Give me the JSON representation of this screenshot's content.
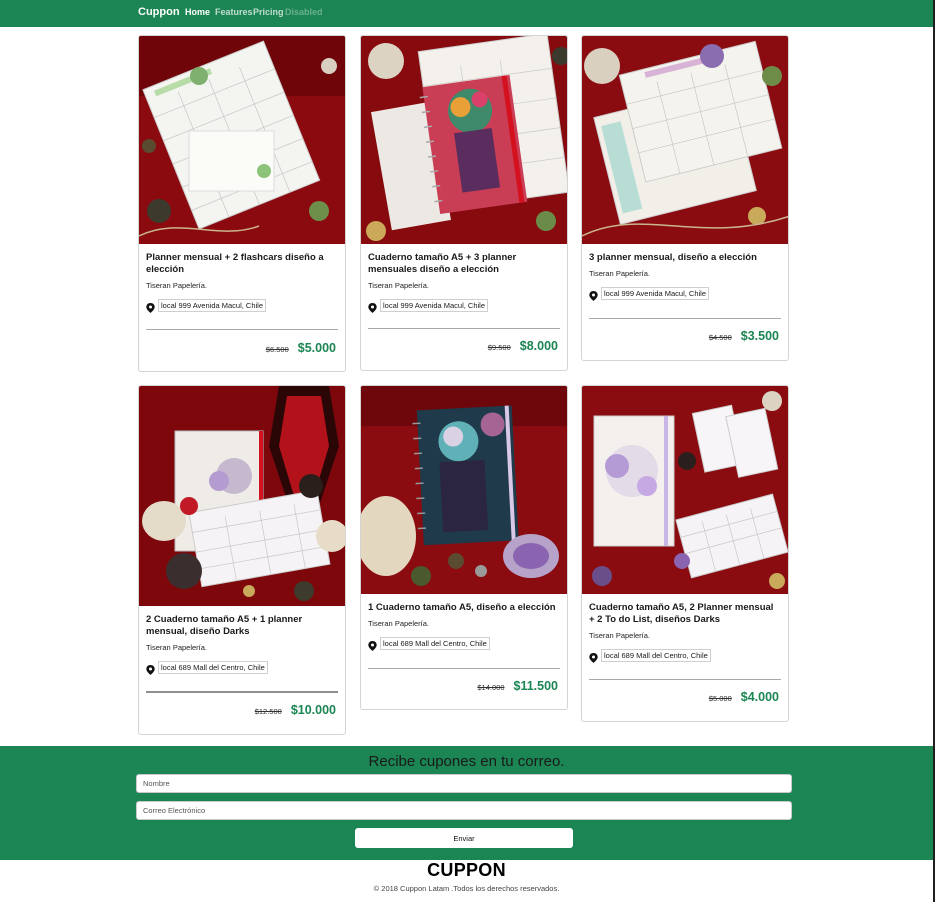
{
  "navbar": {
    "brand": "Cuppon",
    "links": [
      "Home",
      "Features",
      "Pricing",
      "Disabled"
    ],
    "color": "#1b8553"
  },
  "products": [
    {
      "title": "Planner mensual + 2 flashcars diseño a elección",
      "store": "Tiseran Papelería.",
      "location": "local 999 Avenida Macul, Chile",
      "old_price": "$6.500",
      "price": "$5.000",
      "image": "planner-photo"
    },
    {
      "title": "Cuaderno tamaño A5 + 3 planner mensuales diseño a elección",
      "store": "Tiseran Papelería.",
      "location": "local 999 Avenida Macul, Chile",
      "old_price": "$9.500",
      "price": "$8.000",
      "image": "notebook-photo"
    },
    {
      "title": "3 planner mensual, diseño a elección",
      "store": "Tiseran Papelería.",
      "location": "local 999 Avenida Macul, Chile",
      "old_price": "$4.500",
      "price": "$3.500",
      "image": "planner-photo"
    },
    {
      "title": "2 Cuaderno tamaño A5 + 1 planner mensual, diseño Darks",
      "store": "Tiseran Papelería.",
      "location": "local 689 Mall del Centro, Chile",
      "old_price": "$12.500",
      "price": "$10.000",
      "image": "darks-photo"
    },
    {
      "title": "1 Cuaderno tamaño A5, diseño a elección",
      "store": "Tiseran Papelería.",
      "location": "local 689 Mall del Centro, Chile",
      "old_price": "$14.000",
      "price": "$11.500",
      "image": "notebook-photo"
    },
    {
      "title": "Cuaderno tamaño A5, 2 Planner mensual + 2 To do List, diseños Darks",
      "store": "Tiseran Papelería.",
      "location": "local 689 Mall del Centro, Chile",
      "old_price": "$5.000",
      "price": "$4.000",
      "image": "darks-photo"
    }
  ],
  "newsletter": {
    "title": "Recibe cupones en tu correo.",
    "name_placeholder": "Nombre",
    "email_placeholder": "Correo Electrónico",
    "submit_label": "Enviar"
  },
  "footer": {
    "logo": "CUPPON",
    "copyright": "© 2018 Cuppon Latam .Todos los derechos reservados."
  },
  "colors": {
    "accent": "#1b8553",
    "photo_background": "#8b0a0f"
  }
}
